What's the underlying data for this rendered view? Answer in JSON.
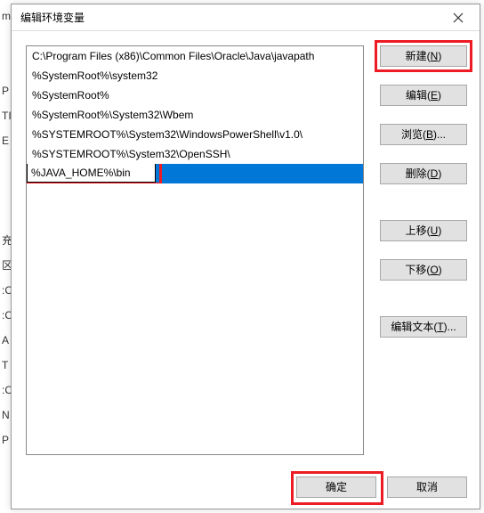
{
  "bg_chars": [
    "m",
    "",
    "",
    "P",
    "TI",
    "E",
    "",
    "",
    "",
    "充",
    "区",
    ":C",
    ":C",
    "A",
    "T",
    ":C",
    "N",
    "P"
  ],
  "title": "编辑环境变量",
  "list": [
    "C:\\Program Files (x86)\\Common Files\\Oracle\\Java\\javapath",
    "%SystemRoot%\\system32",
    "%SystemRoot%",
    "%SystemRoot%\\System32\\Wbem",
    "%SYSTEMROOT%\\System32\\WindowsPowerShell\\v1.0\\",
    "%SYSTEMROOT%\\System32\\OpenSSH\\"
  ],
  "editing_value": "%JAVA_HOME%\\bin",
  "buttons": {
    "new": "新建(N)",
    "edit": "编辑(E)",
    "browse": "浏览(B)...",
    "delete": "删除(D)",
    "moveup": "上移(U)",
    "movedown": "下移(O)",
    "edittext": "编辑文本(T)...",
    "ok": "确定",
    "cancel": "取消"
  }
}
